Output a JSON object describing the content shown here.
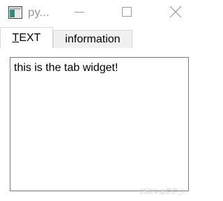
{
  "window": {
    "title": "py...",
    "icon": "app-window-icon",
    "controls": {
      "minimize": "minimize-icon",
      "maximize": "maximize-icon",
      "close": "close-icon"
    }
  },
  "tabs": [
    {
      "label_first": "T",
      "label_rest": "EXT",
      "selected": true
    },
    {
      "label": "information",
      "selected": false
    }
  ],
  "page": {
    "text": "this is the tab widget!"
  },
  "watermark": "CSDN @伊伊_I"
}
